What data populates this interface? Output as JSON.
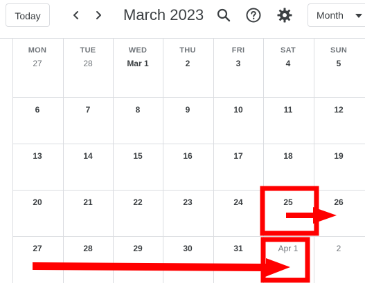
{
  "toolbar": {
    "today_label": "Today",
    "title": "March 2023",
    "view_label": "Month"
  },
  "calendar": {
    "weekdays": [
      "MON",
      "TUE",
      "WED",
      "THU",
      "FRI",
      "SAT",
      "SUN"
    ],
    "weeks": [
      [
        {
          "label": "27",
          "in_month": false
        },
        {
          "label": "28",
          "in_month": false
        },
        {
          "label": "Mar 1",
          "in_month": true
        },
        {
          "label": "2",
          "in_month": true
        },
        {
          "label": "3",
          "in_month": true
        },
        {
          "label": "4",
          "in_month": true
        },
        {
          "label": "5",
          "in_month": true
        }
      ],
      [
        {
          "label": "6",
          "in_month": true
        },
        {
          "label": "7",
          "in_month": true
        },
        {
          "label": "8",
          "in_month": true
        },
        {
          "label": "9",
          "in_month": true
        },
        {
          "label": "10",
          "in_month": true
        },
        {
          "label": "11",
          "in_month": true
        },
        {
          "label": "12",
          "in_month": true
        }
      ],
      [
        {
          "label": "13",
          "in_month": true
        },
        {
          "label": "14",
          "in_month": true
        },
        {
          "label": "15",
          "in_month": true
        },
        {
          "label": "16",
          "in_month": true
        },
        {
          "label": "17",
          "in_month": true
        },
        {
          "label": "18",
          "in_month": true
        },
        {
          "label": "19",
          "in_month": true
        }
      ],
      [
        {
          "label": "20",
          "in_month": true
        },
        {
          "label": "21",
          "in_month": true
        },
        {
          "label": "22",
          "in_month": true
        },
        {
          "label": "23",
          "in_month": true
        },
        {
          "label": "24",
          "in_month": true
        },
        {
          "label": "25",
          "in_month": true
        },
        {
          "label": "26",
          "in_month": true
        }
      ],
      [
        {
          "label": "27",
          "in_month": true
        },
        {
          "label": "28",
          "in_month": true
        },
        {
          "label": "29",
          "in_month": true
        },
        {
          "label": "30",
          "in_month": true
        },
        {
          "label": "31",
          "in_month": true
        },
        {
          "label": "Apr 1",
          "in_month": false
        },
        {
          "label": "2",
          "in_month": false
        }
      ]
    ]
  },
  "icons": {
    "prev": "chevron-left-icon",
    "next": "chevron-right-icon",
    "search": "search-icon",
    "help": "help-icon",
    "settings": "gear-icon",
    "dropdown": "caret-down-icon"
  },
  "colors": {
    "text": "#3c4043",
    "muted_text": "#70757a",
    "border": "#dadce0",
    "annotation": "#ff0000"
  }
}
